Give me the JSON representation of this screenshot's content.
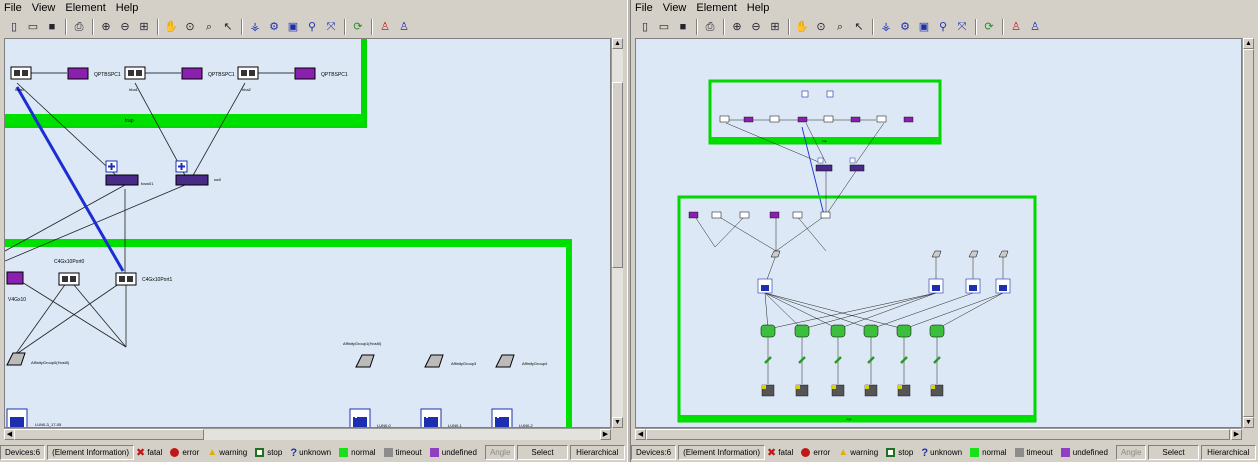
{
  "menus": [
    "File",
    "View",
    "Element",
    "Help"
  ],
  "status": {
    "devices": "Devices:6",
    "info": "(Element Information)",
    "legend": [
      {
        "label": "fatal",
        "color": "#c01818"
      },
      {
        "label": "error",
        "color": "#c01818"
      },
      {
        "label": "warning",
        "color": "#e0b000"
      },
      {
        "label": "stop",
        "color": "#207020"
      },
      {
        "label": "unknown",
        "color": "#1c2fb0"
      },
      {
        "label": "normal",
        "color": "#19e019"
      },
      {
        "label": "timeout",
        "color": "#8c8c8c"
      },
      {
        "label": "undefined",
        "color": "#8f3fc0"
      }
    ],
    "angle": "Angle",
    "select": "Select",
    "layout": "Hierarchical"
  },
  "left": {
    "top_group": "trap",
    "hosts": [
      "hba0",
      "hba1",
      "hba2"
    ],
    "fcs": [
      "QPTBSPC1",
      "QPTBSPC1",
      "QPTBSPC1"
    ],
    "switches": [
      "fcsw01",
      "sw0"
    ],
    "ports": [
      "C4Gx10Port0",
      "C4Gx10Port1"
    ],
    "left_label": "V4Gx10",
    "affinity": [
      "AffinityGroup0(Host0)",
      "AffinityGroup1(Host0)",
      "AffinityGroup3",
      "AffinityGroup4"
    ],
    "luns": [
      "LUN0-3_17-05",
      "LUN0-0",
      "LUN0-1",
      "LUN0-2"
    ]
  },
  "right": {
    "top_group": "trap",
    "bottom_group": "stg1"
  }
}
